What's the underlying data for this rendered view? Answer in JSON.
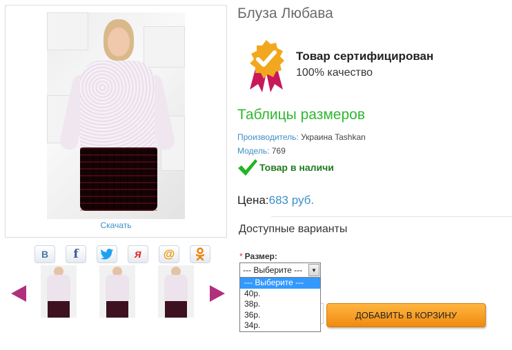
{
  "product": {
    "title": "Блуза Любава",
    "download_label": "Скачать"
  },
  "share": {
    "icons": [
      {
        "name": "vk-icon",
        "glyph": "B",
        "color": "#4a76a8"
      },
      {
        "name": "facebook-icon",
        "glyph": "f",
        "color": "#3b5998"
      },
      {
        "name": "twitter-icon",
        "glyph": "🐦",
        "color": "#1da1f2"
      },
      {
        "name": "yaru-icon",
        "glyph": "я",
        "color": "#e03030"
      },
      {
        "name": "mailru-icon",
        "glyph": "@",
        "color": "#f29400"
      },
      {
        "name": "odnoklassniki-icon",
        "glyph": "ок",
        "color": "#ee8208"
      }
    ]
  },
  "certificate": {
    "title": "Товар сертифицирован",
    "subtitle": "100% качество"
  },
  "size_table_link": "Таблицы размеров",
  "info": {
    "manufacturer_label": "Производитель:",
    "manufacturer_value": " Украина Tashkan",
    "model_label": "Модель:",
    "model_value": " 769",
    "stock_text": "Товар в наличи"
  },
  "price": {
    "label": "Цена:",
    "value": "683 руб."
  },
  "variants": {
    "title": "Доступные варианты",
    "required_mark": "*",
    "size_label": "Размер:",
    "selected": "--- Выберите ---",
    "options": [
      "--- Выберите ---",
      "40р.",
      "38р.",
      "36р.",
      "34р."
    ]
  },
  "cart": {
    "button_label": "ДОБАВИТЬ В КОРЗИНУ"
  },
  "colors": {
    "accent_blue": "#3b8fc8",
    "green_link": "#2fb72f",
    "stock_green": "#1f7a1f",
    "cart_orange": "#f5a020",
    "arrow_purple": "#b0307c"
  }
}
